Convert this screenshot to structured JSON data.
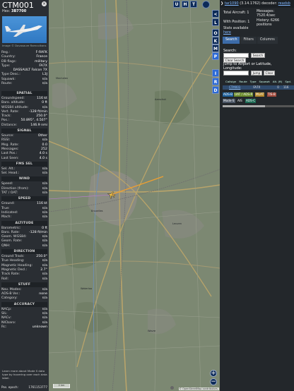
{
  "aircraft": {
    "callsign": "CTM001",
    "hex_label": "Hex:",
    "hex": "3B7700",
    "photo_credit": "Image © Dovosaure Ramcolkans"
  },
  "info_rows": [
    {
      "k": "Reg.:",
      "v": "F-RAFK"
    },
    {
      "k": "Country:",
      "v": "France"
    },
    {
      "k": "DB flags:",
      "v": "military"
    },
    {
      "k": "Type:",
      "v": "FA7X"
    },
    {
      "k": "",
      "v": "DASSAULT Falcon 7X"
    },
    {
      "k": "Type Desc.:",
      "v": "L3J"
    },
    {
      "k": "Squawk:",
      "v": "n/a"
    },
    {
      "k": "Route:",
      "v": "n/a"
    }
  ],
  "sections": [
    {
      "title": "SPATIAL",
      "rows": [
        {
          "k": "Groundspeed:",
          "v": "116 kt"
        },
        {
          "k": "Baro. altitude:",
          "v": "0 ft"
        },
        {
          "k": "WGS84 altitude:",
          "v": "n/a"
        },
        {
          "k": "Vert. Rate:",
          "v": "-128 ft/min"
        },
        {
          "k": "Track:",
          "v": "250.0°"
        },
        {
          "k": "Pos.:",
          "v": "50.895°, 4.507°"
        },
        {
          "k": "Distance:",
          "v": "146.9 nmi"
        }
      ]
    },
    {
      "title": "SIGNAL",
      "rows": [
        {
          "k": "Source:",
          "v": "Other"
        },
        {
          "k": "RSSI:",
          "v": "n/a"
        },
        {
          "k": "Msg. Rate:",
          "v": "0.0"
        },
        {
          "k": "Messages:",
          "v": "252"
        },
        {
          "k": "Last Pos.:",
          "v": "4.0 s"
        },
        {
          "k": "Last Seen:",
          "v": "4.0 s"
        }
      ]
    },
    {
      "title": "FMS SEL",
      "rows": [
        {
          "k": "Sel. Alt.:",
          "v": "n/a"
        },
        {
          "k": "Sel. Head.:",
          "v": "n/a"
        }
      ]
    },
    {
      "title": "WIND",
      "rows": [
        {
          "k": "Speed:",
          "v": "n/a"
        },
        {
          "k": "Direction (from):",
          "v": "n/a"
        },
        {
          "k": "TAT / OAT:",
          "v": "n/a"
        }
      ]
    },
    {
      "title": "SPEED",
      "rows": [
        {
          "k": "Ground:",
          "v": "116 kt"
        },
        {
          "k": "True:",
          "v": "n/a"
        },
        {
          "k": "Indicated:",
          "v": "n/a"
        },
        {
          "k": "Mach:",
          "v": "n/a"
        }
      ]
    },
    {
      "title": "ALTITUDE",
      "rows": [
        {
          "k": "Barometric:",
          "v": "0 ft"
        },
        {
          "k": "Baro. Rate:",
          "v": "-128 ft/min"
        },
        {
          "k": "Geom. WGS84:",
          "v": "n/a"
        },
        {
          "k": "Geom. Rate:",
          "v": "n/a"
        },
        {
          "k": "QNH:",
          "v": "n/a"
        }
      ]
    },
    {
      "title": "DIRECTION",
      "rows": [
        {
          "k": "Ground Track:",
          "v": "250.0°"
        },
        {
          "k": "True Heading:",
          "v": "n/a"
        },
        {
          "k": "Magnetic Heading:",
          "v": "n/a"
        },
        {
          "k": "Magnetic Decl.:",
          "v": "2.7°"
        },
        {
          "k": "Track Rate:",
          "v": "n/a"
        },
        {
          "k": "Roll:",
          "v": "n/a"
        }
      ]
    },
    {
      "title": "STUFF",
      "rows": [
        {
          "k": "Nav. Modes:",
          "v": "n/a"
        },
        {
          "k": "ADS-B Ver.:",
          "v": "none"
        },
        {
          "k": "Category:",
          "v": "n/a"
        }
      ]
    },
    {
      "title": "ACCURACY",
      "rows": [
        {
          "k": "NACp:",
          "v": "n/a"
        },
        {
          "k": "SIL:",
          "v": "n/a"
        },
        {
          "k": "NACv:",
          "v": "n/a"
        },
        {
          "k": "NICbaro:",
          "v": "n/a"
        },
        {
          "k": "Rc:",
          "v": "unknown"
        }
      ]
    }
  ],
  "note": "Learn more about Mode S data type by hovering over each data label.",
  "epoch_label": "Pos. epoch:",
  "epoch_value": "1761153777",
  "map_buttons": [
    "U",
    "H",
    "T"
  ],
  "toolbar_buttons": [
    "<",
    "L",
    "O",
    "K",
    "M",
    "P",
    "I",
    "R",
    "D"
  ],
  "map": {
    "scale": "2 km",
    "attribution": "© OpenStreetMap contributors.",
    "zoom_in": "+",
    "zoom_out": "−",
    "aircraft_color": "#f3c44a",
    "trail_color": "#f0a030",
    "route_color": "#c07ad8"
  },
  "panel": {
    "version_link": "tar1090",
    "version_text": "(3.14.1762) decoder:",
    "decoder": "readsb",
    "total_label": "Total Aircraft: 1",
    "messages_label": "Messages:",
    "messages_value": "7520.4/sec",
    "with_pos_label": "With Position: 1",
    "history_label": "History: 6266 positions",
    "stats_label": "Stats available",
    "stats_link": "here",
    "tabs": [
      "Search",
      "Filters",
      "Columns"
    ],
    "search_label": "Search:",
    "search_button": "Search",
    "clear_search": "Clear Search",
    "jump_label": "Jump to Airport or Latitude, Longitude:",
    "jump_button": "Jump",
    "clear_button": "Clear",
    "table_headers": [
      "Callsign",
      "Route",
      "Type",
      "Squawk",
      "Alt. (ft)",
      "Spd."
    ],
    "table_row": {
      "callsign": "CTM001",
      "type": "FA7X",
      "alt": "0",
      "spd": "116"
    },
    "badges": [
      {
        "label": "ADS-B",
        "color": "#1c5f9a"
      },
      {
        "label": "UAT / ADS-R",
        "color": "#6a8a2a"
      },
      {
        "label": "MLAT",
        "color": "#b4882a"
      },
      {
        "label": "TIS-B",
        "color": "#a14a3c"
      },
      {
        "label": "Mode-S",
        "color": "#4b5666"
      },
      {
        "label": "AIS",
        "color": "#23272b"
      },
      {
        "label": "ADS-C",
        "color": "#1d6b55"
      }
    ]
  }
}
